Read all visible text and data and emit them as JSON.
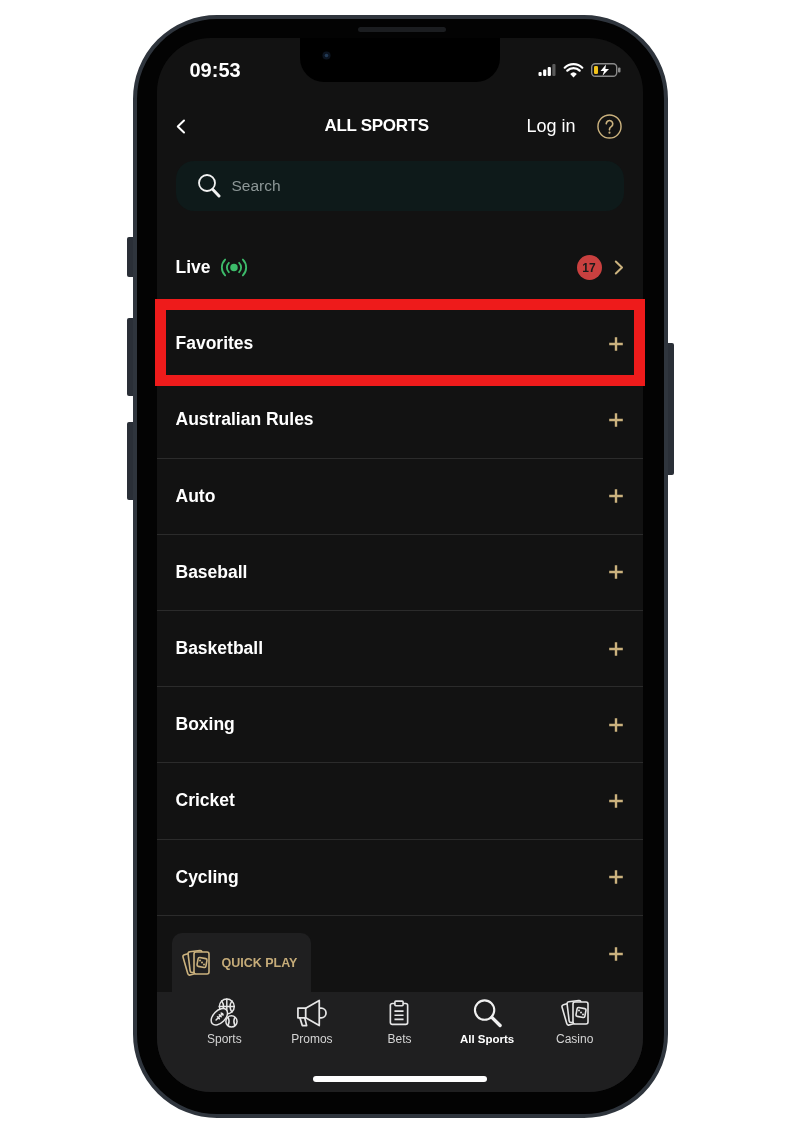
{
  "status_bar": {
    "time": "09:53"
  },
  "header": {
    "title": "ALL SPORTS",
    "login_link": "Log in"
  },
  "search": {
    "placeholder": "Search"
  },
  "live": {
    "label": "Live",
    "count": "17"
  },
  "categories": [
    {
      "label": "Favorites",
      "highlighted": true
    },
    {
      "label": "Australian Rules",
      "highlighted": false
    },
    {
      "label": "Auto",
      "highlighted": false
    },
    {
      "label": "Baseball",
      "highlighted": false
    },
    {
      "label": "Basketball",
      "highlighted": false
    },
    {
      "label": "Boxing",
      "highlighted": false
    },
    {
      "label": "Cricket",
      "highlighted": false
    },
    {
      "label": "Cycling",
      "highlighted": false
    },
    {
      "highlighted": false
    }
  ],
  "quick_play": {
    "label": "QUICK PLAY"
  },
  "tab_bar": [
    {
      "label": "Sports",
      "selected": false
    },
    {
      "label": "Promos",
      "selected": false
    },
    {
      "label": "Bets",
      "selected": false
    },
    {
      "label": "All Sports",
      "selected": true
    },
    {
      "label": "Casino",
      "selected": false
    }
  ]
}
